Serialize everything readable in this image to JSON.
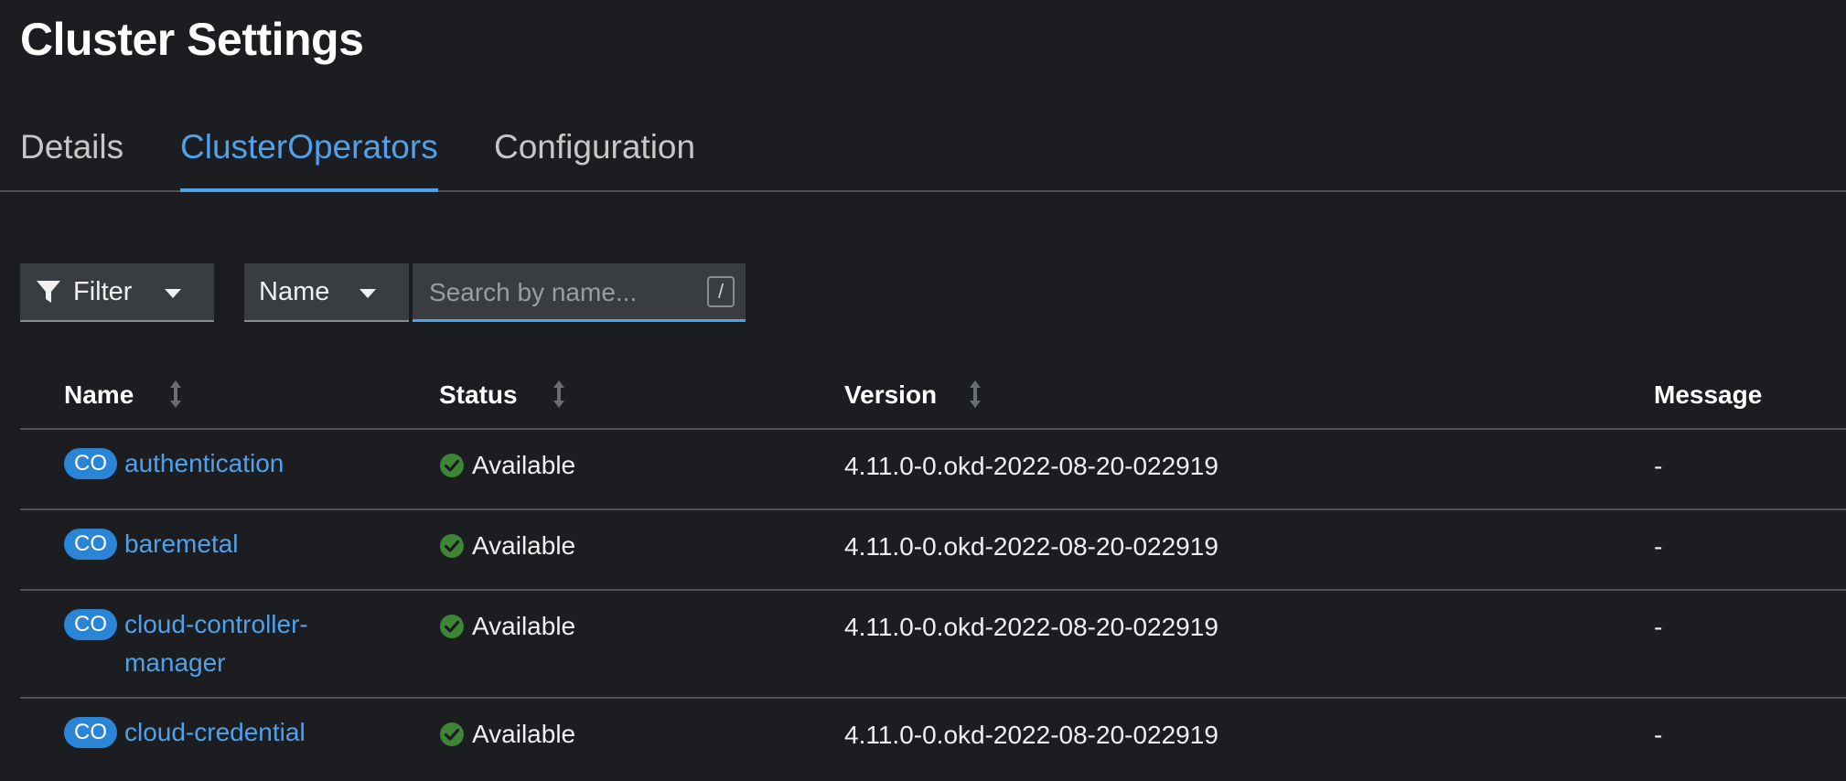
{
  "page": {
    "title": "Cluster Settings"
  },
  "tabs": [
    {
      "label": "Details"
    },
    {
      "label": "ClusterOperators"
    },
    {
      "label": "Configuration"
    }
  ],
  "toolbar": {
    "filter_label": "Filter",
    "attribute_label": "Name",
    "search_placeholder": "Search by name...",
    "search_value": "",
    "shortcut_key": "/"
  },
  "table": {
    "columns": {
      "name": "Name",
      "status": "Status",
      "version": "Version",
      "message": "Message"
    },
    "rows": [
      {
        "badge": "CO",
        "name": "authentication",
        "status": "Available",
        "version": "4.11.0-0.okd-2022-08-20-022919",
        "message": "-"
      },
      {
        "badge": "CO",
        "name": "baremetal",
        "status": "Available",
        "version": "4.11.0-0.okd-2022-08-20-022919",
        "message": "-"
      },
      {
        "badge": "CO",
        "name_line1": "cloud-controller-",
        "name_line2": "manager",
        "status": "Available",
        "version": "4.11.0-0.okd-2022-08-20-022919",
        "message": "-"
      },
      {
        "badge": "CO",
        "name": "cloud-credential",
        "status": "Available",
        "version": "4.11.0-0.okd-2022-08-20-022919",
        "message": "-"
      }
    ]
  },
  "colors": {
    "accent": "#4fa1ea",
    "badge": "#2b85d6",
    "success": "#3e8635",
    "background": "#1b1d21"
  },
  "icons": {
    "filter": "filter-icon",
    "sort": "sort-icon",
    "status": "check-circle-icon",
    "caret": "caret-down-icon"
  }
}
